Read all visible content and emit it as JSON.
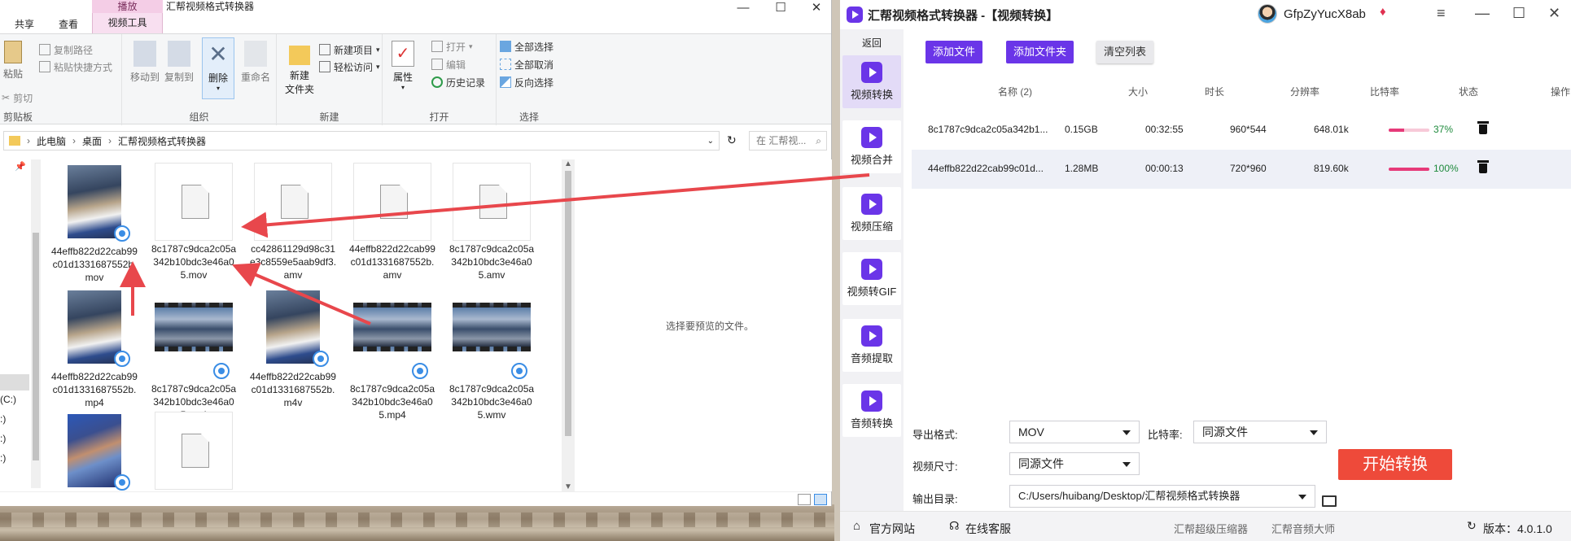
{
  "explorer": {
    "tabs": [
      "共享",
      "查看"
    ],
    "context_tab_head": "播放",
    "context_tab": "视频工具",
    "title": "汇帮视频格式转换器",
    "ribbon": {
      "clipboard": {
        "label": "剪贴板",
        "paste": "粘贴",
        "copy_path": "复制路径",
        "paste_shortcut": "粘贴快捷方式",
        "cut": "剪切"
      },
      "organize": {
        "label": "组织",
        "move_to": "移动到",
        "copy_to": "复制到",
        "delete": "删除",
        "rename": "重命名"
      },
      "new": {
        "label": "新建",
        "new_folder": "新建\n文件夹",
        "new_item": "新建项目",
        "easy_access": "轻松访问"
      },
      "open": {
        "label": "打开",
        "properties": "属性",
        "open": "打开",
        "edit": "编辑",
        "history": "历史记录"
      },
      "select": {
        "label": "选择",
        "select_all": "全部选择",
        "select_none": "全部取消",
        "invert": "反向选择"
      }
    },
    "breadcrumb": [
      "此电脑",
      "桌面",
      "汇帮视频格式转换器"
    ],
    "search_placeholder": "在 汇帮视...",
    "nav_items": [
      "(C:)",
      ":)",
      ":)",
      ":)"
    ],
    "files": [
      {
        "name": "44effb822d22cab99c01d1331687552b.mov",
        "thumb": "portrait"
      },
      {
        "name": "8c1787c9dca2c05a342b10bdc3e46a05.mov",
        "thumb": "doc"
      },
      {
        "name": "cc42861129d98c31e3c8559e5aab9df3.amv",
        "thumb": "doc"
      },
      {
        "name": "44effb822d22cab99c01d1331687552b.amv",
        "thumb": "doc"
      },
      {
        "name": "8c1787c9dca2c05a342b10bdc3e46a05.amv",
        "thumb": "doc"
      },
      {
        "name": "44effb822d22cab99c01d1331687552b.mp4",
        "thumb": "portrait"
      },
      {
        "name": "8c1787c9dca2c05a342b10bdc3e46a05.mv4",
        "thumb": "film"
      },
      {
        "name": "44effb822d22cab99c01d1331687552b.m4v",
        "thumb": "portrait"
      },
      {
        "name": "8c1787c9dca2c05a342b10bdc3e46a05.mp4",
        "thumb": "film"
      },
      {
        "name": "8c1787c9dca2c05a342b10bdc3e46a05.wmv",
        "thumb": "film"
      },
      {
        "name": "",
        "thumb": "portrait-alt"
      },
      {
        "name": "",
        "thumb": "doc"
      }
    ],
    "preview_text": "选择要预览的文件。"
  },
  "app": {
    "title": "汇帮视频格式转换器 -【视频转换】",
    "username": "GfpZyYucX8ab",
    "window_controls": [
      "≡",
      "—",
      "☐",
      "✕"
    ],
    "back": "返回",
    "sidebar": [
      "视频转换",
      "视频合并",
      "视频压缩",
      "视频转GIF",
      "音频提取",
      "音频转换"
    ],
    "toolbar": {
      "add_file": "添加文件",
      "add_folder": "添加文件夹",
      "clear_list": "清空列表"
    },
    "table": {
      "headers": [
        "名称 (2)",
        "大小",
        "时长",
        "分辨率",
        "比特率",
        "状态",
        "操作"
      ],
      "rows": [
        {
          "name": "8c1787c9dca2c05a342b1...",
          "size": "0.15GB",
          "duration": "00:32:55",
          "resolution": "960*544",
          "bitrate": "648.01k",
          "progress": 0.37,
          "percent": "37%"
        },
        {
          "name": "44effb822d22cab99c01d...",
          "size": "1.28MB",
          "duration": "00:00:13",
          "resolution": "720*960",
          "bitrate": "819.60k",
          "progress": 1.0,
          "percent": "100%"
        }
      ]
    },
    "settings": {
      "format_label": "导出格式:",
      "format_value": "MOV",
      "bitrate_label": "比特率:",
      "bitrate_value": "同源文件",
      "size_label": "视频尺寸:",
      "size_value": "同源文件",
      "output_label": "输出目录:",
      "output_value": "C:/Users/huibang/Desktop/汇帮视频格式转换器",
      "start": "开始转换"
    },
    "footer": {
      "website": "官方网站",
      "support": "在线客服",
      "link1": "汇帮超级压缩器",
      "link2": "汇帮音频大师",
      "version": "版本：4.0.1.0"
    }
  },
  "colors": {
    "accent": "#6a35e8",
    "start": "#ee4a3a",
    "arrow": "#e8474c",
    "progress": "#e63a79"
  }
}
